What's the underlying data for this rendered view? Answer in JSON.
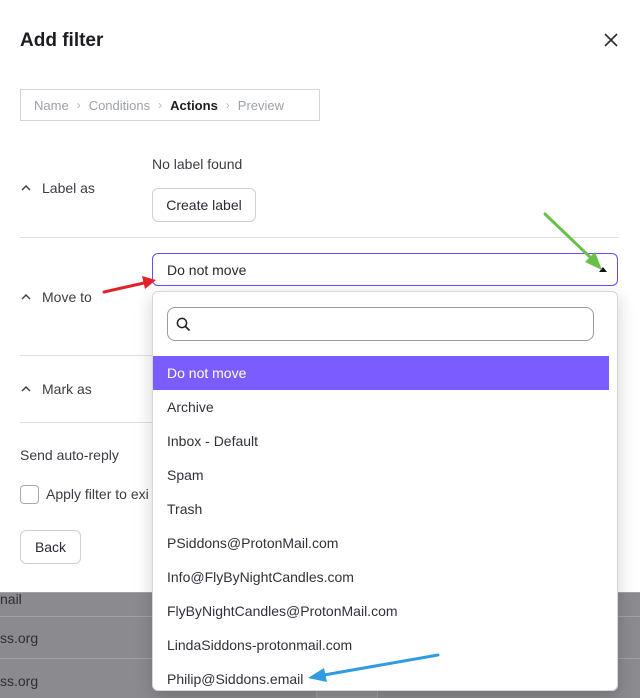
{
  "background": {
    "rows": [
      "nail",
      "ss.org",
      "ss.org"
    ]
  },
  "modal": {
    "title": "Add filter",
    "stepper": {
      "steps": [
        "Name",
        "Conditions",
        "Actions",
        "Preview"
      ],
      "active": "Actions"
    },
    "label_as": {
      "label": "Label as",
      "empty_text": "No label found",
      "create_button": "Create label"
    },
    "move_to": {
      "label": "Move to",
      "selected": "Do not move"
    },
    "mark_as": {
      "label": "Mark as"
    },
    "send_auto_reply": "Send auto-reply",
    "apply_filter": "Apply filter to exi",
    "back_button": "Back"
  },
  "dropdown": {
    "search_placeholder": "",
    "options": [
      "Do not move",
      "Archive",
      "Inbox - Default",
      "Spam",
      "Trash",
      "PSiddons@ProtonMail.com",
      "Info@FlyByNightCandles.com",
      "FlyByNightCandles@ProtonMail.com",
      "LindaSiddons-protonmail.com",
      "Philip@Siddons.email"
    ],
    "selected_index": 0
  },
  "colors": {
    "accent": "#6d4aff",
    "selected_bg": "#7b5cff",
    "annotation_red": "#e0232a",
    "annotation_green": "#6abf4b",
    "annotation_blue": "#2f9be0"
  }
}
